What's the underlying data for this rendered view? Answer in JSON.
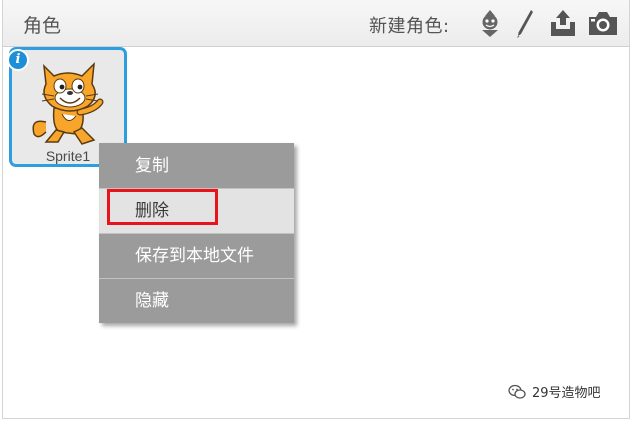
{
  "header": {
    "title": "角色",
    "new_sprite_label": "新建角色:"
  },
  "toolbar": {
    "icons": [
      "sprite-library-icon",
      "paint-brush-icon",
      "upload-icon",
      "camera-icon"
    ]
  },
  "sprite": {
    "name": "Sprite1",
    "selected": true,
    "info_badge": "i"
  },
  "context_menu": {
    "items": [
      {
        "label": "复制"
      },
      {
        "label": "删除"
      },
      {
        "label": "保存到本地文件"
      },
      {
        "label": "隐藏"
      }
    ],
    "highlighted_index": 1
  },
  "watermark": {
    "text": "29号造物吧"
  },
  "colors": {
    "selection_border": "#2d9fe0",
    "menu_background": "#9b9b9b",
    "menu_highlight": "#e3e3e3",
    "annotation_red": "#e8141b"
  }
}
